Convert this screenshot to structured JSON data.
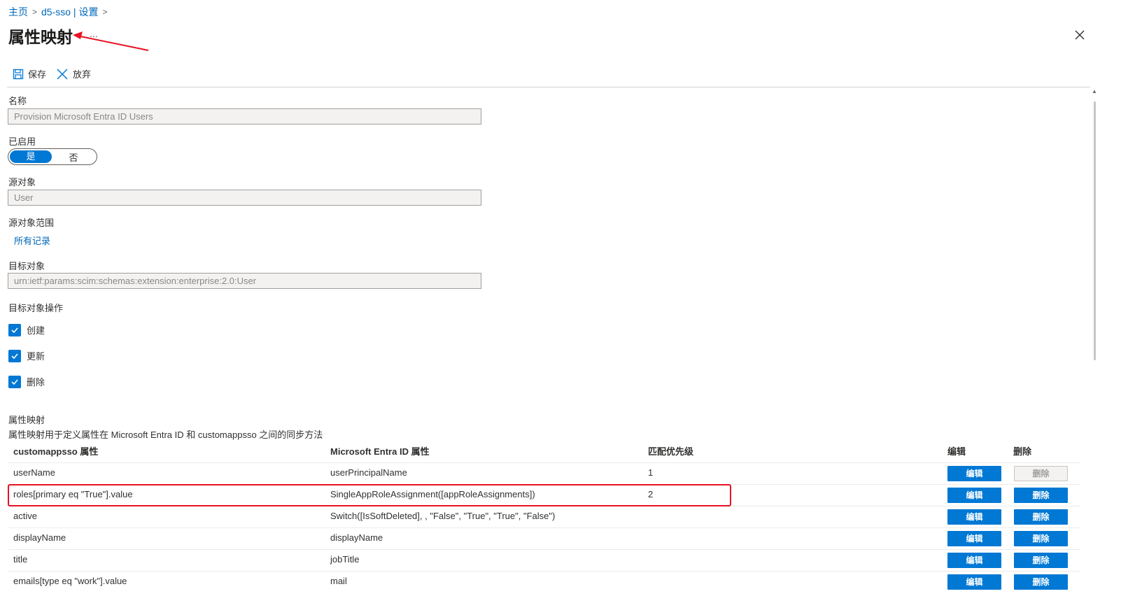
{
  "breadcrumb": {
    "home": "主页",
    "app": "d5-sso | 设置"
  },
  "page": {
    "title": "属性映射",
    "more": "..."
  },
  "toolbar": {
    "save_label": "保存",
    "discard_label": "放弃"
  },
  "form": {
    "name_label": "名称",
    "name_value": "Provision Microsoft Entra ID Users",
    "enabled_label": "已启用",
    "enabled_yes": "是",
    "enabled_no": "否",
    "source_object_label": "源对象",
    "source_object_value": "User",
    "source_scope_label": "源对象范围",
    "source_scope_link": "所有记录",
    "target_object_label": "目标对象",
    "target_object_value": "urn:ietf:params:scim:schemas:extension:enterprise:2.0:User",
    "target_actions_label": "目标对象操作",
    "actions": [
      {
        "label": "创建",
        "checked": true
      },
      {
        "label": "更新",
        "checked": true
      },
      {
        "label": "删除",
        "checked": true
      }
    ]
  },
  "mappings": {
    "section_title": "属性映射",
    "description": "属性映射用于定义属性在 Microsoft Entra ID 和 customappsso 之间的同步方法",
    "columns": {
      "target": "customappsso 属性",
      "source": "Microsoft Entra ID 属性",
      "priority": "匹配优先级",
      "edit": "编辑",
      "delete": "删除"
    },
    "rows": [
      {
        "target": "userName",
        "source": "userPrincipalName",
        "priority": "1",
        "edit": "编辑",
        "delete": "删除",
        "delete_enabled": false
      },
      {
        "target": "roles[primary eq \"True\"].value",
        "source": "SingleAppRoleAssignment([appRoleAssignments])",
        "priority": "2",
        "edit": "编辑",
        "delete": "删除",
        "delete_enabled": true
      },
      {
        "target": "active",
        "source": "Switch([IsSoftDeleted], , \"False\", \"True\", \"True\", \"False\")",
        "priority": "",
        "edit": "编辑",
        "delete": "删除",
        "delete_enabled": true
      },
      {
        "target": "displayName",
        "source": "displayName",
        "priority": "",
        "edit": "编辑",
        "delete": "删除",
        "delete_enabled": true
      },
      {
        "target": "title",
        "source": "jobTitle",
        "priority": "",
        "edit": "编辑",
        "delete": "删除",
        "delete_enabled": true
      },
      {
        "target": "emails[type eq \"work\"].value",
        "source": "mail",
        "priority": "",
        "edit": "编辑",
        "delete": "删除",
        "delete_enabled": true
      }
    ]
  },
  "colors": {
    "accent": "#0078d4",
    "link": "#0067b8",
    "annotation": "#e81123"
  }
}
